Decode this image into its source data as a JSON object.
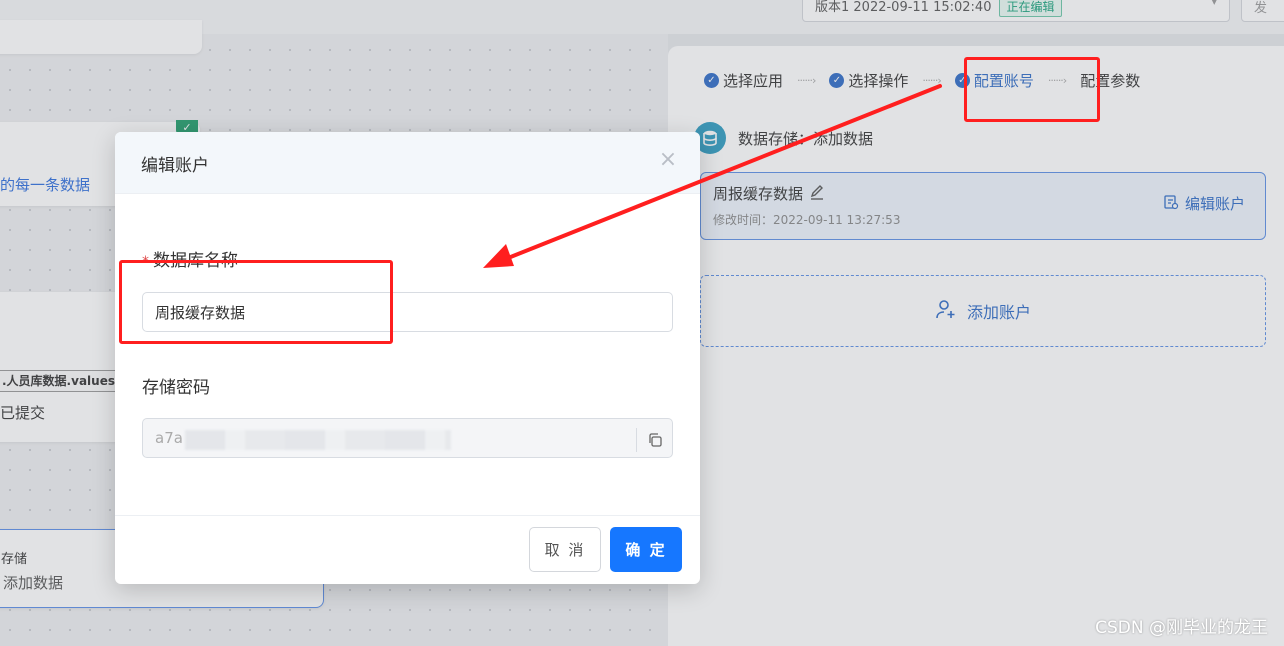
{
  "topbar": {
    "version_text": "版本1 2022-09-11 15:02:40",
    "version_badge": "正在编辑",
    "extra_button": "发"
  },
  "canvas": {
    "node1_text": "的每一条数据",
    "node2_code": ".人员库数据.values",
    "node2_status": "已提交",
    "node3_title": "存储",
    "node3_action": "添加数据"
  },
  "steps": [
    {
      "label": "选择应用",
      "done": true
    },
    {
      "label": "选择操作",
      "done": true
    },
    {
      "label": "配置账号",
      "done": true,
      "current": true
    },
    {
      "label": "配置参数",
      "done": false
    }
  ],
  "app": {
    "name": "数据存储",
    "separator": "：",
    "action": "添加数据"
  },
  "account": {
    "name": "周报缓存数据",
    "modified_time": "修改时间：2022-09-11 13:27:53",
    "edit_label": "编辑账户"
  },
  "add_account_label": "添加账户",
  "modal": {
    "title": "编辑账户",
    "db_name_label": "数据库名称",
    "required_mark": "*",
    "db_name_value": "周报缓存数据",
    "password_label": "存储密码",
    "password_value": "a7a",
    "cancel_label": "取 消",
    "ok_label": "确 定"
  },
  "colors": {
    "primary": "#1677ff",
    "link": "#2e6bc7",
    "annotation": "#ff1f1f",
    "success_badge": "#17a27b"
  },
  "watermark": "CSDN @刚毕业的龙王"
}
